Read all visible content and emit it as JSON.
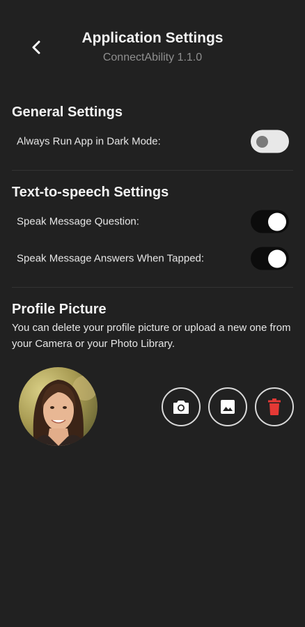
{
  "header": {
    "title": "Application Settings",
    "subtitle": "ConnectAbility 1.1.0"
  },
  "general": {
    "title": "General Settings",
    "settings": [
      {
        "label": "Always Run App in Dark Mode:",
        "enabled": false
      }
    ]
  },
  "tts": {
    "title": "Text-to-speech Settings",
    "settings": [
      {
        "label": "Speak Message Question:",
        "enabled": true
      },
      {
        "label": "Speak Message Answers When Tapped:",
        "enabled": true
      }
    ]
  },
  "profile": {
    "title": "Profile Picture",
    "description": "You can delete your profile picture or upload a new one from your Camera or your Photo Library.",
    "actions": [
      {
        "icon": "camera-icon"
      },
      {
        "icon": "image-icon"
      },
      {
        "icon": "trash-icon"
      }
    ]
  },
  "colors": {
    "background": "#212121",
    "toggle_on_track": "#0c0c0c",
    "toggle_off_track": "#e8e8e8",
    "delete_red": "#e53935"
  }
}
